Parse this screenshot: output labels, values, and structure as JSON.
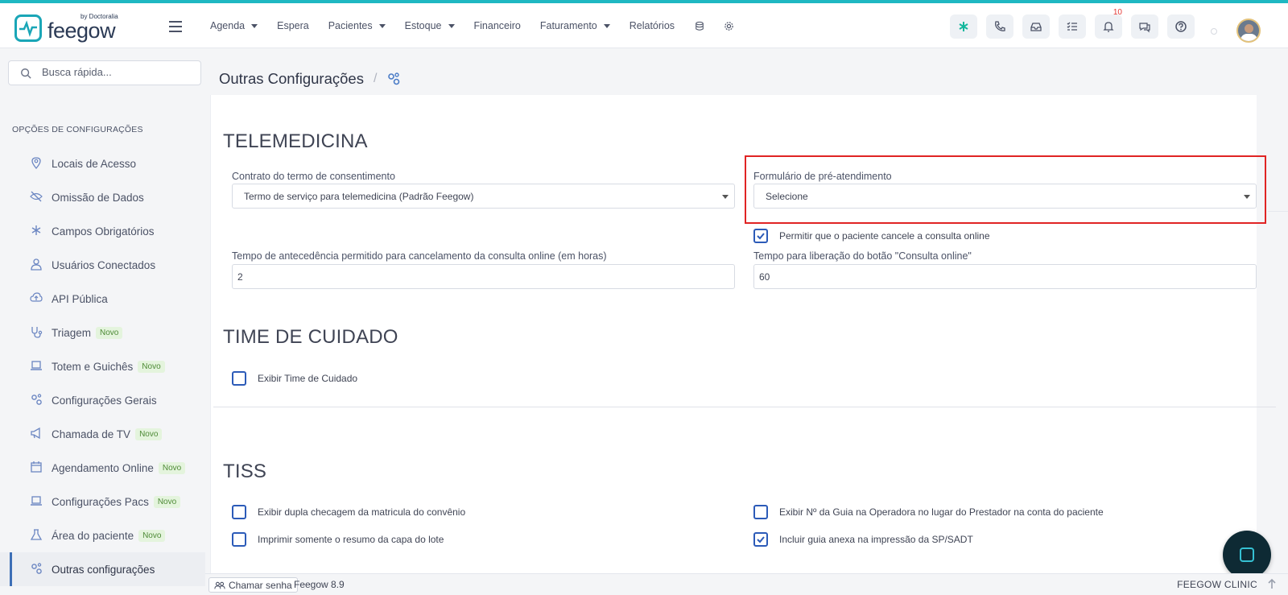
{
  "brand": {
    "name": "feegow",
    "tagline": "by Doctoralia"
  },
  "topnav": {
    "items": [
      {
        "label": "Agenda",
        "has_caret": true
      },
      {
        "label": "Espera",
        "has_caret": false
      },
      {
        "label": "Pacientes",
        "has_caret": true
      },
      {
        "label": "Estoque",
        "has_caret": true
      },
      {
        "label": "Financeiro",
        "has_caret": false
      },
      {
        "label": "Faturamento",
        "has_caret": true
      },
      {
        "label": "Relatórios",
        "has_caret": false
      }
    ],
    "icons": [
      "database-icon",
      "settings-gear-icon"
    ]
  },
  "header_actions": {
    "buttons": [
      "asterisk-icon",
      "phone-icon",
      "inbox-icon",
      "checklist-icon",
      "bell-icon",
      "chat-icon",
      "help-icon"
    ],
    "notification_count": "10"
  },
  "sidebar": {
    "search_placeholder": "Busca rápida...",
    "section_title": "OPÇÕES DE CONFIGURAÇÕES",
    "items": [
      {
        "label": "Locais de Acesso",
        "icon": "location-icon",
        "novo": ""
      },
      {
        "label": "Omissão de Dados",
        "icon": "eye-off-icon",
        "novo": ""
      },
      {
        "label": "Campos Obrigatórios",
        "icon": "asterisk-icon",
        "novo": ""
      },
      {
        "label": "Usuários Conectados",
        "icon": "user-icon",
        "novo": ""
      },
      {
        "label": "API Pública",
        "icon": "cloud-upload-icon",
        "novo": ""
      },
      {
        "label": "Triagem",
        "icon": "stethoscope-icon",
        "novo": "Novo"
      },
      {
        "label": "Totem e Guichês",
        "icon": "laptop-icon",
        "novo": "Novo"
      },
      {
        "label": "Configurações Gerais",
        "icon": "gears-icon",
        "novo": ""
      },
      {
        "label": "Chamada de TV",
        "icon": "megaphone-icon",
        "novo": "Novo"
      },
      {
        "label": "Agendamento Online",
        "icon": "calendar-icon",
        "novo": "Novo"
      },
      {
        "label": "Configurações Pacs",
        "icon": "laptop-icon",
        "novo": "Novo"
      },
      {
        "label": "Área do paciente",
        "icon": "flask-icon",
        "novo": "Novo"
      },
      {
        "label": "Outras configurações",
        "icon": "gears-icon",
        "novo": "",
        "active": true
      }
    ]
  },
  "breadcrumb": {
    "title": "Outras Configurações",
    "separator": "/"
  },
  "telemedicina": {
    "title": "TELEMEDICINA",
    "contrato_label": "Contrato do termo de consentimento",
    "contrato_value": "Termo de serviço para telemedicina (Padrão Feegow)",
    "formulario_label": "Formulário de pré-atendimento",
    "formulario_value": "Selecione",
    "permitir_cancelar_label": "Permitir que o paciente cancele a consulta online",
    "permitir_cancelar_checked": true,
    "tempo_antecedencia_label": "Tempo de antecedência permitido para cancelamento da consulta online (em horas)",
    "tempo_antecedencia_value": "2",
    "tempo_liberacao_label": "Tempo para liberação do botão \"Consulta online\"",
    "tempo_liberacao_value": "60"
  },
  "time_cuidado": {
    "title": "TIME DE CUIDADO",
    "exibir_label": "Exibir Time de Cuidado",
    "exibir_checked": false
  },
  "tiss": {
    "title": "TISS",
    "left": [
      {
        "label": "Exibir dupla checagem da matricula do convênio",
        "checked": false
      },
      {
        "label": "Imprimir somente o resumo da capa do lote",
        "checked": false
      }
    ],
    "right": [
      {
        "label": "Exibir Nº da Guia na Operadora no lugar do Prestador na conta do paciente",
        "checked": false
      },
      {
        "label": "Incluir guia anexa na impressão da SP/SADT",
        "checked": true
      }
    ]
  },
  "footer": {
    "chamar_senha": "Chamar senha",
    "version": "Feegow 8.9",
    "clinic": "FEEGOW CLINIC"
  },
  "colors": {
    "accent": "#1fb8c2",
    "primary_blue": "#2c5bb8",
    "highlight_red": "#e02424"
  }
}
